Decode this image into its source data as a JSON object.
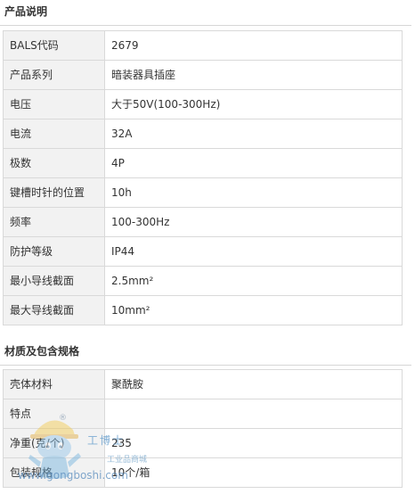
{
  "sections": [
    {
      "title": "产品说明",
      "rows": [
        {
          "label": "BALS代码",
          "value": "2679"
        },
        {
          "label": "产品系列",
          "value": "暗装器具插座"
        },
        {
          "label": "电压",
          "value": "大于50V(100-300Hz)"
        },
        {
          "label": "电流",
          "value": "32A"
        },
        {
          "label": "极数",
          "value": "4P"
        },
        {
          "label": "键槽时针的位置",
          "value": "10h"
        },
        {
          "label": "频率",
          "value": "100-300Hz"
        },
        {
          "label": "防护等级",
          "value": "IP44"
        },
        {
          "label": "最小导线截面",
          "value": "2.5mm²"
        },
        {
          "label": "最大导线截面",
          "value": "10mm²"
        }
      ]
    },
    {
      "title": "材质及包含规格",
      "rows": [
        {
          "label": "壳体材料",
          "value": "聚酰胺"
        },
        {
          "label": "特点",
          "value": ""
        },
        {
          "label": "净重(克/个)",
          "value": "235"
        },
        {
          "label": "包装规格",
          "value": "10个/箱"
        }
      ]
    }
  ],
  "watermark": {
    "brand_cn": "工博士",
    "subtitle": "工业品商城",
    "url": "www.gongboshi.com",
    "registered": "®"
  },
  "colors": {
    "label_bg": "#f2f2f2",
    "border": "#d9d9d9",
    "text": "#333333"
  }
}
